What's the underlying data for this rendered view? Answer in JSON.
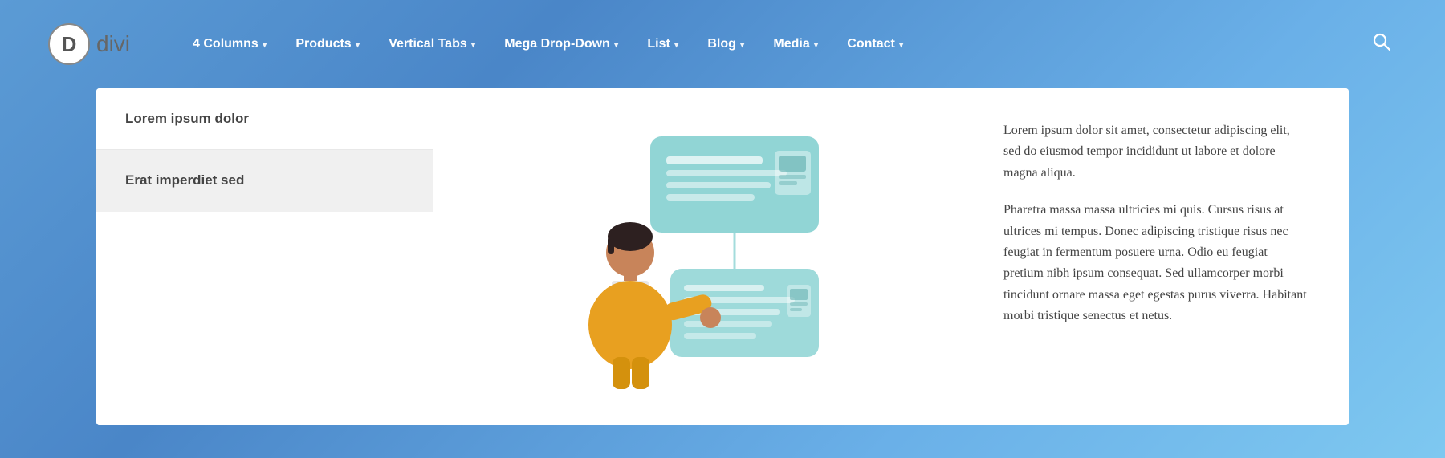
{
  "logo": {
    "letter": "D",
    "text": "divi"
  },
  "nav": {
    "items": [
      {
        "label": "4 Columns",
        "has_dropdown": true
      },
      {
        "label": "Products",
        "has_dropdown": true
      },
      {
        "label": "Vertical Tabs",
        "has_dropdown": true
      },
      {
        "label": "Mega Drop-Down",
        "has_dropdown": true
      },
      {
        "label": "List",
        "has_dropdown": true
      },
      {
        "label": "Blog",
        "has_dropdown": true
      },
      {
        "label": "Media",
        "has_dropdown": true
      },
      {
        "label": "Contact",
        "has_dropdown": true
      }
    ]
  },
  "sidebar": {
    "items": [
      {
        "label": "Lorem ipsum dolor"
      },
      {
        "label": "Erat imperdiet sed"
      }
    ]
  },
  "content": {
    "paragraph1": "Lorem ipsum dolor sit amet, consectetur adipiscing elit, sed do eiusmod tempor incididunt ut labore et dolore magna aliqua.",
    "paragraph2": "Pharetra massa massa ultricies mi quis. Cursus risus at ultrices mi tempus. Donec adipiscing tristique risus nec feugiat in fermentum posuere urna. Odio eu feugiat pretium nibh ipsum consequat. Sed ullamcorper morbi tincidunt ornare massa eget egestas purus viverra. Habitant morbi tristique senectus et netus."
  },
  "colors": {
    "accent": "#5b9bd5",
    "nav_text": "#ffffff",
    "body_text": "#444444"
  }
}
